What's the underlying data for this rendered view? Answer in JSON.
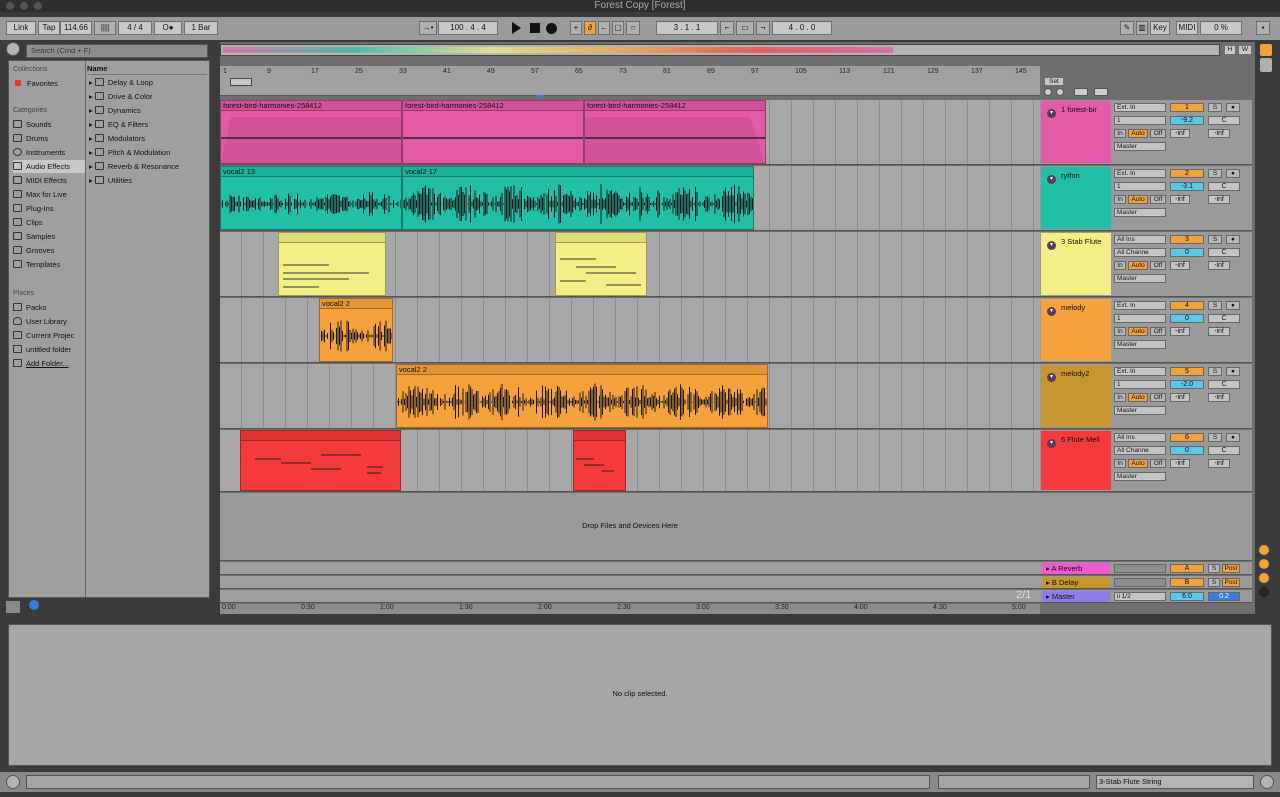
{
  "window": {
    "title": "Forest Copy  [Forest]"
  },
  "transport": {
    "link": "Link",
    "tap": "Tap",
    "tempo": "114.66",
    "time_sig": "4 / 4",
    "metronome": "O●",
    "quantize": "1 Bar",
    "position": "100 .   4 .   4",
    "loop_start": "3 .   1 .   1",
    "loop_length": "4 .   0 .   0",
    "key": "Key",
    "midi": "MIDI",
    "cpu": "0 %",
    "colors": {
      "accent": "#f2a23a",
      "highlight": "#5bc8ea"
    }
  },
  "browser": {
    "search_placeholder": "Search (Cmd + F)",
    "collections_header": "Collections",
    "favorites": "Favorites",
    "categories_header": "Categories",
    "categories": [
      "Sounds",
      "Drums",
      "Instruments",
      "Audio Effects",
      "MIDI Effects",
      "Max for Live",
      "Plug-Ins",
      "Clips",
      "Samples",
      "Grooves",
      "Templates"
    ],
    "places_header": "Places",
    "places": [
      "Packs",
      "User Library",
      "Current Projec",
      "untitled folder",
      "Add Folder..."
    ],
    "name_header": "Name",
    "items": [
      "Delay & Loop",
      "Drive & Color",
      "Dynamics",
      "EQ & Filters",
      "Modulators",
      "Pitch & Modulation",
      "Reverb & Resonance",
      "Utilities"
    ]
  },
  "ruler": {
    "bars": [
      "1",
      "9",
      "17",
      "25",
      "33",
      "41",
      "49",
      "57",
      "65",
      "73",
      "81",
      "89",
      "97",
      "105",
      "113",
      "121",
      "129",
      "137",
      "145"
    ],
    "set_label": "Set",
    "h": "H",
    "w": "W"
  },
  "tracks": [
    {
      "name": "1 forest-bir",
      "input": "Ext. In",
      "channel": "1",
      "number": "1",
      "vol": "-9.2",
      "pan": "C",
      "color": "#e35aa8",
      "clips": [
        {
          "name": "forest-bird-harmonies-258412"
        },
        {
          "name": "forest-bird-harmonies-258412"
        },
        {
          "name": "forest-bird-harmonies-258412"
        }
      ]
    },
    {
      "name": "rythm",
      "input": "Ext. In",
      "channel": "1",
      "number": "2",
      "vol": "-3.1",
      "pan": "C",
      "color": "#21bfa8",
      "clips": [
        {
          "name": "vocal2 13"
        },
        {
          "name": "vocal2 17"
        }
      ]
    },
    {
      "name": "3 Stab Flute",
      "input": "All Ins",
      "channel": "All Channe",
      "number": "3",
      "vol": "0",
      "pan": "C",
      "color": "#f4ee86",
      "clips": [
        {
          "name": ""
        },
        {
          "name": ""
        }
      ]
    },
    {
      "name": "melody",
      "input": "Ext. In",
      "channel": "1",
      "number": "4",
      "vol": "0",
      "pan": "C",
      "color": "#f6a23c",
      "clips": [
        {
          "name": "vocal2 2"
        }
      ]
    },
    {
      "name": "melody2",
      "input": "Ext. In",
      "channel": "1",
      "number": "5",
      "vol": "-2.0",
      "pan": "C",
      "color": "#c8962e",
      "clips": [
        {
          "name": "vocal2 2"
        }
      ]
    },
    {
      "name": "6 Flute Mell",
      "input": "All Ins",
      "channel": "All Channe",
      "number": "6",
      "vol": "0",
      "pan": "C",
      "color": "#f43a3a",
      "clips": [
        {
          "name": ""
        },
        {
          "name": ""
        }
      ]
    }
  ],
  "mix_labels": {
    "in": "In",
    "auto": "Auto",
    "off": "Off",
    "out": "Master",
    "inf": "-inf",
    "solo": "S"
  },
  "returns": [
    {
      "name": "A Reverb",
      "letter": "A",
      "post": "Post",
      "color": "#f05ad0"
    },
    {
      "name": "B Delay",
      "letter": "B",
      "post": "Post",
      "color": "#c8962e"
    }
  ],
  "master": {
    "name": "Master",
    "routing": "ii 1/2",
    "vol": "6.0",
    "pan": "0.2",
    "color": "#8a80e8"
  },
  "drop_text": "Drop Files and Devices Here",
  "time_ruler": [
    "0:00",
    "0:30",
    "1:00",
    "1:30",
    "2:00",
    "2:30",
    "3:00",
    "3:30",
    "4:00",
    "4:30",
    "5:00"
  ],
  "page_indicator": "2/1",
  "detail": {
    "message": "No clip selected."
  },
  "status": {
    "track": "3-Stab Flute String"
  }
}
